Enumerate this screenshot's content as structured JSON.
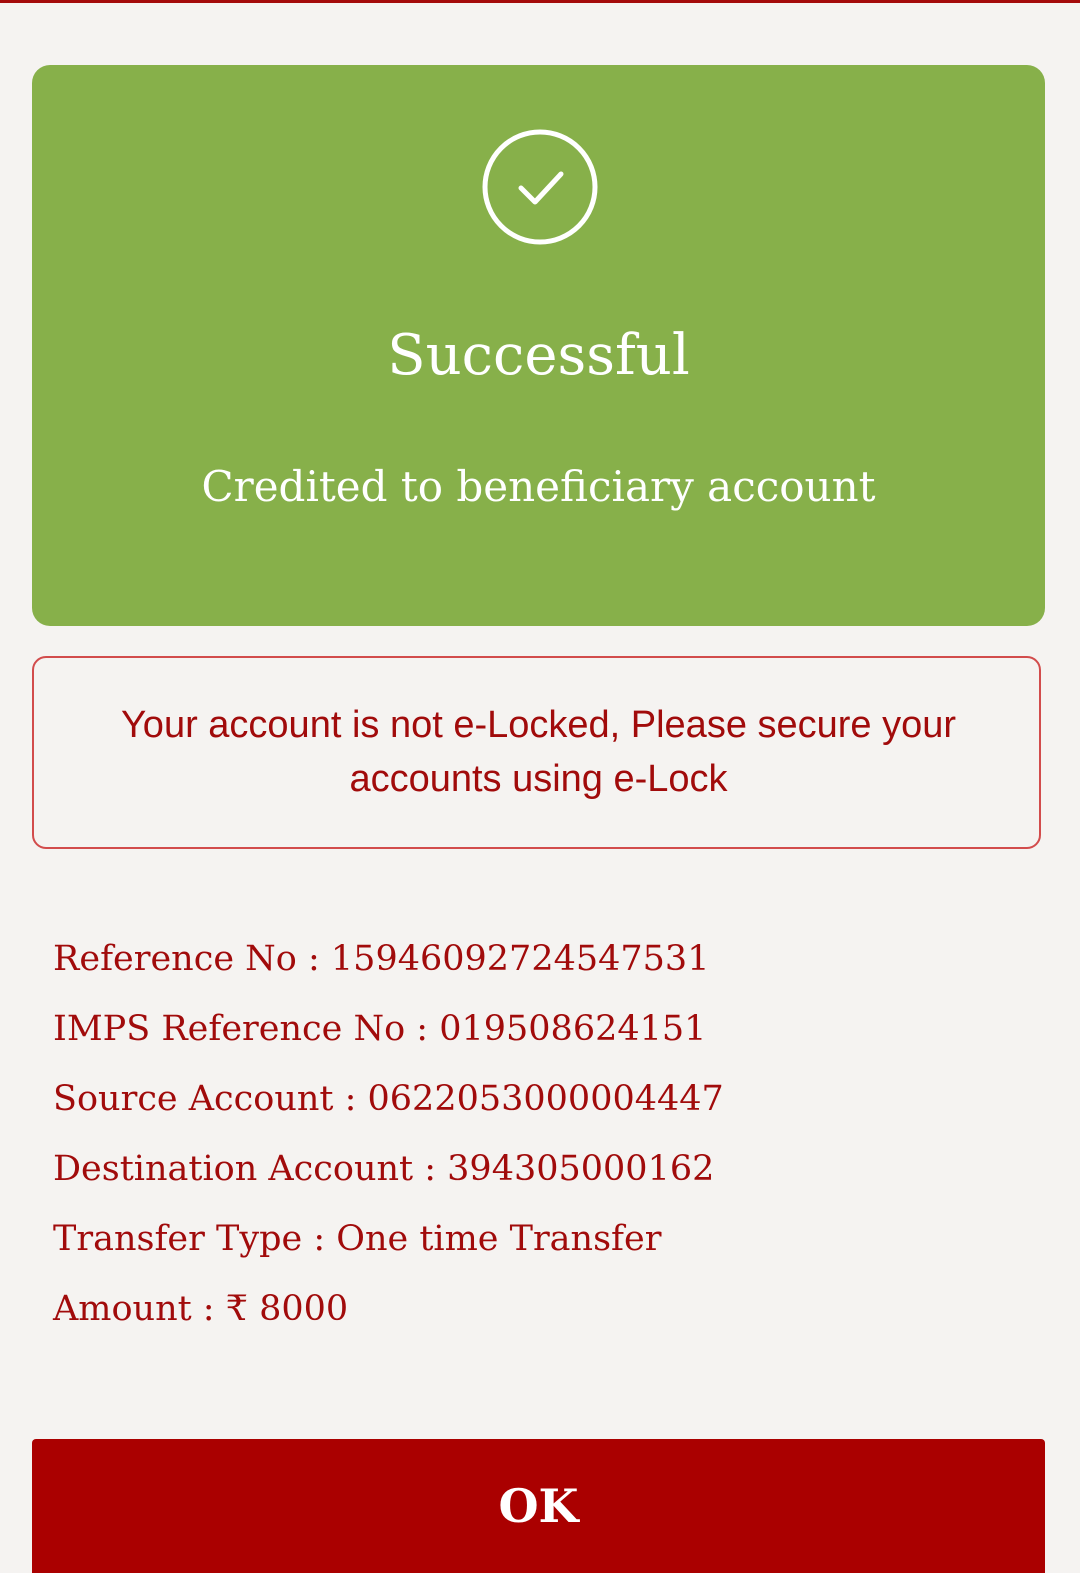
{
  "success": {
    "icon": "check-circle-icon",
    "title": "Successful",
    "subtitle": "Credited to beneficiary account",
    "color": "#87b04a"
  },
  "notice": {
    "line1": "Your account is not e-Locked, Please secure your",
    "line2": "accounts using e-Lock",
    "border_color": "#d24c4c"
  },
  "details": [
    {
      "label": "Reference No : ",
      "value": "15946092724547531"
    },
    {
      "label": "IMPS Reference No : ",
      "value": "019508624151"
    },
    {
      "label": "Source Account : ",
      "value": "0622053000004447"
    },
    {
      "label": "Destination Account : ",
      "value": "394305000162"
    },
    {
      "label": "Transfer Type : ",
      "value": "One time Transfer"
    },
    {
      "label": "Amount : ",
      "value": "₹ 8000"
    }
  ],
  "ok_button": {
    "label": "OK",
    "color": "#aa0000"
  },
  "text_color": "#a10b0b"
}
